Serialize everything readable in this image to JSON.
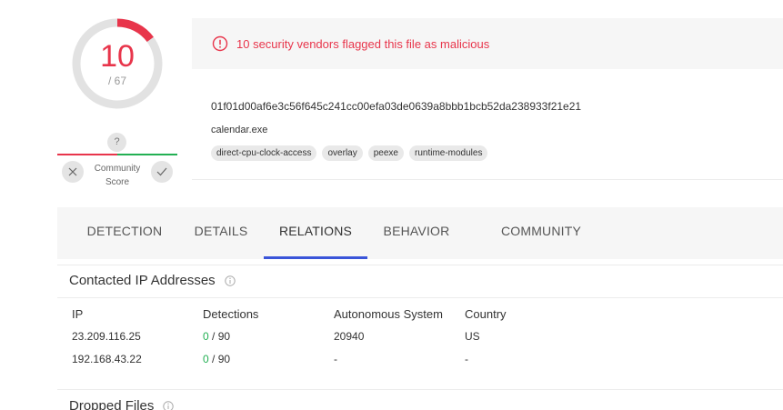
{
  "detection_score": {
    "positives": "10",
    "total": "/ 67",
    "malicious_fraction": 0.149
  },
  "community_score": {
    "unknown_symbol": "?",
    "label_line1": "Community",
    "label_line2": "Score"
  },
  "alert": {
    "message": "10 security vendors flagged this file as malicious"
  },
  "file": {
    "hash": "01f01d00af6e3c56f645c241cc00efa03de0639a8bbb1bcb52da238933f21e21",
    "name": "calendar.exe",
    "tags": [
      "direct-cpu-clock-access",
      "overlay",
      "peexe",
      "runtime-modules"
    ]
  },
  "tabs": [
    {
      "label": "DETECTION",
      "active": false
    },
    {
      "label": "DETAILS",
      "active": false
    },
    {
      "label": "RELATIONS",
      "active": true
    },
    {
      "label": "BEHAVIOR",
      "active": false
    },
    {
      "label": "COMMUNITY",
      "active": false
    }
  ],
  "contacted_ips": {
    "title": "Contacted IP Addresses",
    "columns": [
      "IP",
      "Detections",
      "Autonomous System",
      "Country"
    ],
    "rows": [
      {
        "ip": "23.209.116.25",
        "det_pos": "0",
        "det_total": " / 90",
        "as": "20940",
        "country": "US"
      },
      {
        "ip": "192.168.43.22",
        "det_pos": "0",
        "det_total": " / 90",
        "as": "-",
        "country": "-"
      }
    ]
  },
  "dropped_files": {
    "title": "Dropped Files"
  },
  "colors": {
    "malicious": "#e8354b",
    "clean": "#23b053",
    "accent": "#3a55d9"
  }
}
